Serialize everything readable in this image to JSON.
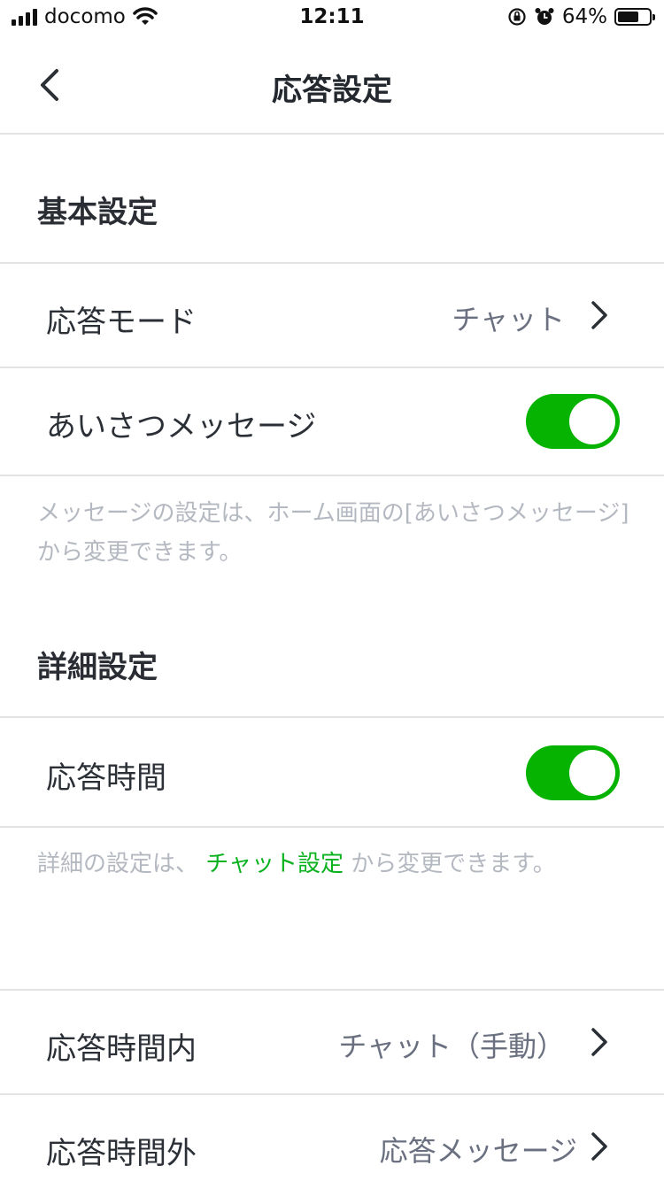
{
  "status_bar": {
    "carrier": "docomo",
    "time": "12:11",
    "battery": "64%"
  },
  "nav": {
    "title": "応答設定"
  },
  "basic": {
    "header": "基本設定",
    "response_mode": {
      "label": "応答モード",
      "value": "チャット"
    },
    "greeting": {
      "label": "あいさつメッセージ",
      "enabled": true
    },
    "note": "メッセージの設定は、ホーム画面の[あいさつメッセージ]から変更できます。"
  },
  "detail": {
    "header": "詳細設定",
    "response_time": {
      "label": "応答時間",
      "enabled": true
    },
    "note_prefix": "詳細の設定は、",
    "note_link": "チャット設定",
    "note_suffix": "から変更できます。",
    "within_hours": {
      "label": "応答時間内",
      "value": "チャット（手動）"
    },
    "outside_hours": {
      "label": "応答時間外",
      "value": "応答メッセージ"
    }
  },
  "colors": {
    "accent": "#06b300",
    "link": "#0bb21f",
    "note": "#b4b8c0"
  }
}
